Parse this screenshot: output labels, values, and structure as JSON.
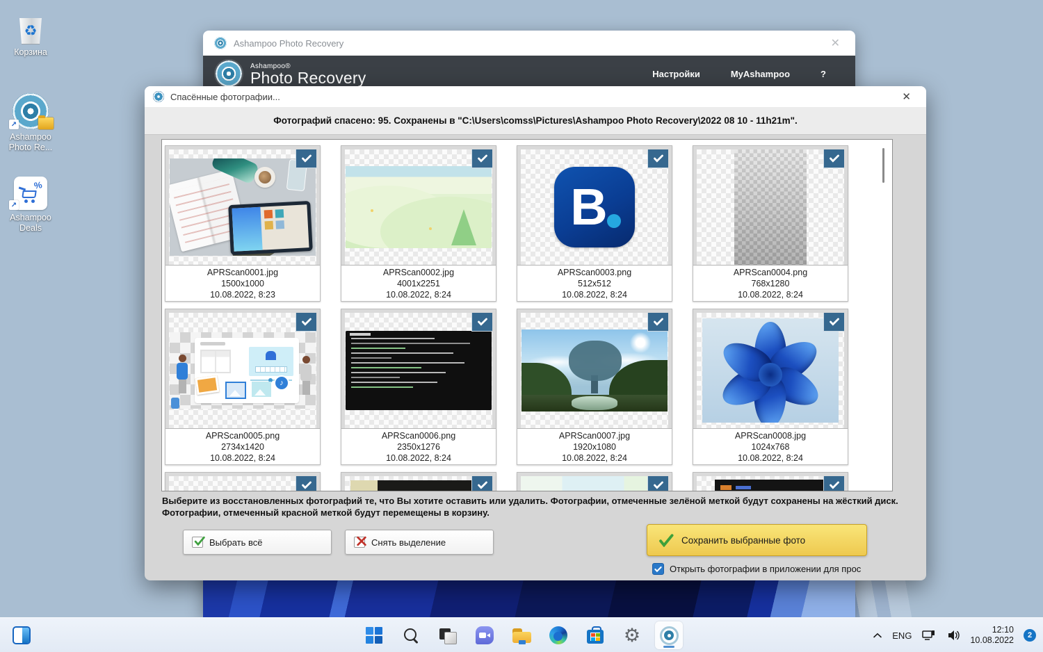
{
  "desktop": {
    "icons": [
      {
        "label": "Корзина"
      },
      {
        "label": "Ashampoo Photo Re..."
      },
      {
        "label": "Ashampoo Deals"
      }
    ]
  },
  "app_window": {
    "title": "Ashampoo Photo Recovery",
    "brand_small": "Ashampoo®",
    "brand_large": "Photo Recovery",
    "menu": {
      "settings": "Настройки",
      "myashampoo": "MyAshampoo",
      "help": "?"
    },
    "close": "✕"
  },
  "dialog": {
    "title": "Спасённые фотографии...",
    "close": "✕",
    "info": "Фотографий спасено: 95. Сохранены в \"C:\\Users\\comss\\Pictures\\Ashampoo Photo Recovery\\2022 08 10 - 11h21m\".",
    "photos": [
      {
        "name": "APRScan0001.jpg",
        "size": "1500x1000",
        "date": "10.08.2022, 8:23"
      },
      {
        "name": "APRScan0002.jpg",
        "size": "4001x2251",
        "date": "10.08.2022, 8:24"
      },
      {
        "name": "APRScan0003.png",
        "size": "512x512",
        "date": "10.08.2022, 8:24"
      },
      {
        "name": "APRScan0004.png",
        "size": "768x1280",
        "date": "10.08.2022, 8:24"
      },
      {
        "name": "APRScan0005.png",
        "size": "2734x1420",
        "date": "10.08.2022, 8:24"
      },
      {
        "name": "APRScan0006.png",
        "size": "2350x1276",
        "date": "10.08.2022, 8:24"
      },
      {
        "name": "APRScan0007.jpg",
        "size": "1920x1080",
        "date": "10.08.2022, 8:24"
      },
      {
        "name": "APRScan0008.jpg",
        "size": "1024x768",
        "date": "10.08.2022, 8:24"
      }
    ],
    "instructions": "Выберите из восстановленных фотографий те, что Вы хотите оставить или удалить. Фотографии, отмеченные зелёной меткой будут сохранены на жёсткий диск. Фотографии, отмеченный красной меткой будут перемещены в корзину.",
    "buttons": {
      "select_all": "Выбрать всё",
      "deselect": "Снять выделение",
      "save_selected": "Сохранить выбранные фото"
    },
    "open_after_label": "Открыть фотографии в приложении для прос"
  },
  "taskbar": {
    "language": "ENG",
    "time": "12:10",
    "date": "10.08.2022",
    "badge_count": "2"
  },
  "colors": {
    "check_badge_blue": "#36688f",
    "save_button_yellow": "#eec94f",
    "app_header_dark": "#3b4046",
    "desktop_blue": "#a9bed2"
  }
}
